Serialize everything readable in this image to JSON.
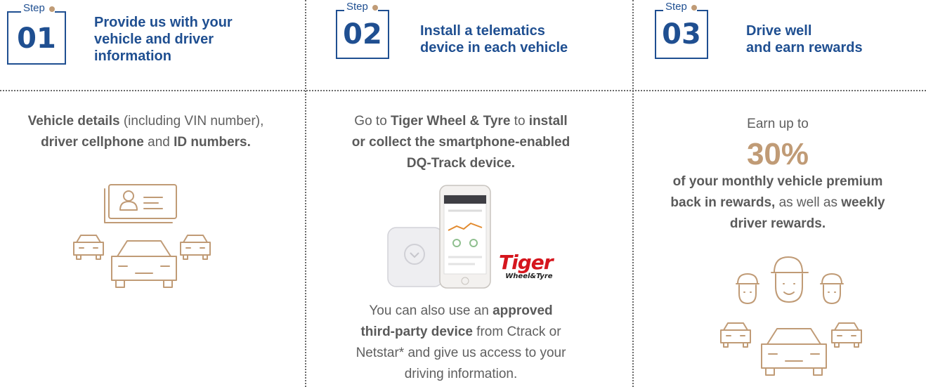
{
  "steps": [
    {
      "step_label": "Step",
      "number": "01",
      "title_lines": [
        "Provide us with your",
        "vehicle and driver",
        "information"
      ],
      "body": {
        "b1": "Vehicle details",
        "t1": " (including VIN number),",
        "b2": "driver cellphone",
        "t2": " and ",
        "b3": "ID numbers."
      },
      "icons": [
        "id-card-icon",
        "car-icon"
      ]
    },
    {
      "step_label": "Step",
      "number": "02",
      "title_lines": [
        "Install a telematics",
        "device in each vehicle"
      ],
      "body": {
        "t1": "Go to ",
        "b1": "Tiger Wheel & Tyre",
        "t2": " to ",
        "b2": "install",
        "b3": "or collect the smartphone-enabled",
        "b4": "DQ-Track device."
      },
      "brand": {
        "logo_main": "Tiger",
        "logo_sub": "Wheel&Tyre"
      },
      "footer": {
        "t1": "You can also use an ",
        "b1": "approved",
        "b2": "third-party device",
        "t2": " from Ctrack or",
        "t3": "Netstar* and give us access to your",
        "t4": "driving information."
      },
      "icons": [
        "smartphone-icon",
        "tracker-device-icon"
      ]
    },
    {
      "step_label": "Step",
      "number": "03",
      "title_lines": [
        "Drive well",
        "and earn rewards"
      ],
      "body": {
        "t1": "Earn up to",
        "big": "30%",
        "b1": "of your monthly vehicle premium",
        "b2": "back in rewards,",
        "t2": " as well as ",
        "b3": "weekly",
        "b4": "driver rewards."
      },
      "icons": [
        "drivers-icon",
        "car-icon"
      ]
    }
  ],
  "colors": {
    "primary": "#1f4f91",
    "accent": "#c09b76",
    "text": "#5f5f5f",
    "logo_red": "#d5161e"
  }
}
